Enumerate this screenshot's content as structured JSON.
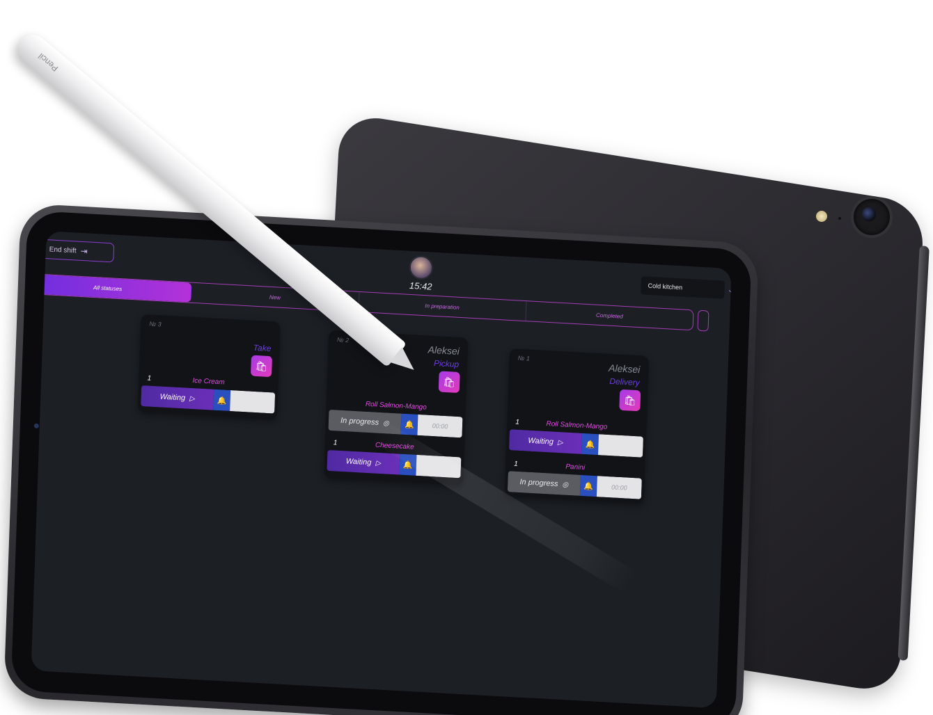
{
  "header": {
    "end_shift_label": "End shift",
    "clock": "15:42",
    "kitchen_select": "Cold kitchen"
  },
  "status_tabs": [
    {
      "label": "All statuses",
      "active": true
    },
    {
      "label": "New",
      "active": false
    },
    {
      "label": "In preparation",
      "active": false
    },
    {
      "label": "Completed",
      "active": false
    }
  ],
  "orders": [
    {
      "number": "№ 3",
      "name": "",
      "type": "Take",
      "items": [
        {
          "qty": "1",
          "title": "Ice Cream",
          "state": "Waiting",
          "timer": ""
        }
      ]
    },
    {
      "number": "№ 2",
      "name": "Aleksei",
      "type": "Pickup",
      "items": [
        {
          "qty": "",
          "title": "Roll Salmon-Mango",
          "state": "In progress",
          "timer": "00:00"
        },
        {
          "qty": "1",
          "title": "Cheesecake",
          "state": "Waiting",
          "timer": ""
        }
      ]
    },
    {
      "number": "№ 1",
      "name": "Aleksei",
      "type": "Delivery",
      "items": [
        {
          "qty": "1",
          "title": "Roll Salmon-Mango",
          "state": "Waiting",
          "timer": ""
        },
        {
          "qty": "1",
          "title": "Panini",
          "state": "In progress",
          "timer": "00:00"
        }
      ]
    }
  ],
  "pencil": {
    "brand": "Pencil"
  },
  "colors": {
    "accent_purple": "#a43fb8",
    "waiting": "#4f2aa2",
    "in_progress": "#5b5c61",
    "bell": "#2a4fbf",
    "item_title": "#e04de0",
    "order_type": "#6d3fe0"
  },
  "icons": {
    "end_shift": "door-exit-icon",
    "bag": "shopping-bag-icon",
    "bell": "bell-icon",
    "play": "play-icon",
    "progress": "pan-icon",
    "chevron": "chevron-down-icon"
  }
}
